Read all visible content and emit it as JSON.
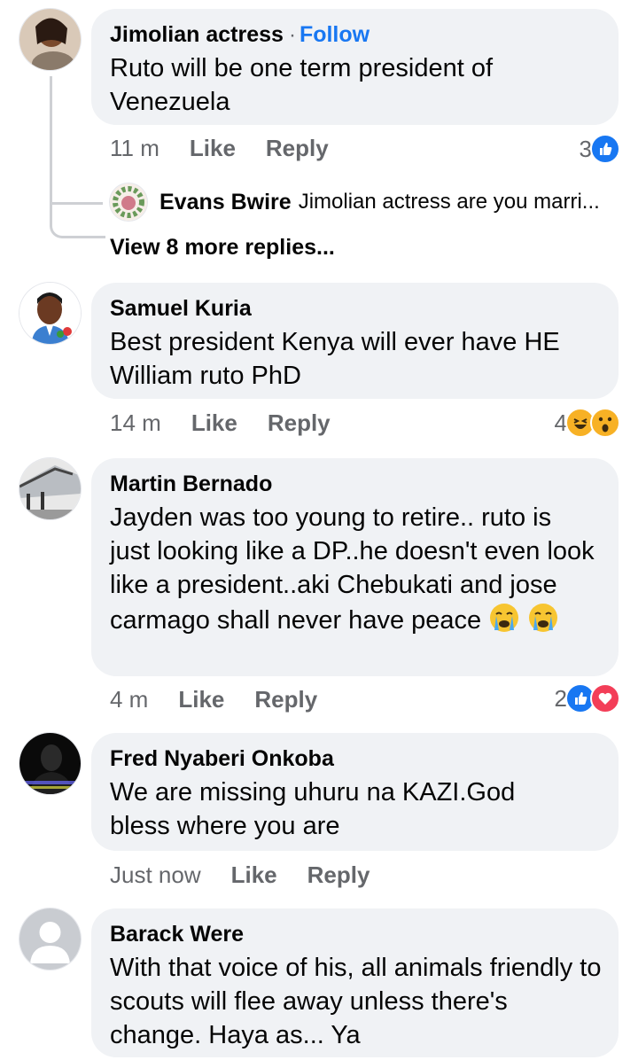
{
  "comments": [
    {
      "author": "Jimolian actress",
      "separator": "·",
      "follow": "Follow",
      "text": "Ruto  will  be one term  president  of Venezuela",
      "time": "11 m",
      "like": "Like",
      "reply": "Reply",
      "reaction_count": "3",
      "reactions": [
        "like-icon"
      ],
      "replies": {
        "preview_author": "Evans Bwire",
        "preview_text": "Jimolian actress are you marri...",
        "view_more": "View 8 more replies..."
      }
    },
    {
      "author": "Samuel Kuria",
      "text": "Best president Kenya will ever have HE William ruto PhD",
      "time": "14 m",
      "like": "Like",
      "reply": "Reply",
      "reaction_count": "4",
      "reactions": [
        "haha-icon",
        "wow-icon"
      ]
    },
    {
      "author": "Martin Bernado",
      "text": "Jayden was too young to retire.. ruto is just looking like a DP..he doesn't even look like a president..aki Chebukati and jose carmago shall never have peace",
      "time": "4 m",
      "like": "Like",
      "reply": "Reply",
      "reaction_count": "2",
      "reactions": [
        "like-icon",
        "love-icon"
      ]
    },
    {
      "author": "Fred Nyaberi Onkoba",
      "text": "We are missing  uhuru na KAZI.God bless where you are",
      "time": "Just now",
      "like": "Like",
      "reply": "Reply"
    },
    {
      "author": "Barack Were",
      "text": "With that voice of his, all animals friendly to scouts will flee away unless there's change. Haya as... Ya"
    }
  ],
  "colors": {
    "accent": "#1877f2",
    "bubble": "#f0f2f5",
    "meta": "#65676b",
    "love": "#f33e58"
  }
}
